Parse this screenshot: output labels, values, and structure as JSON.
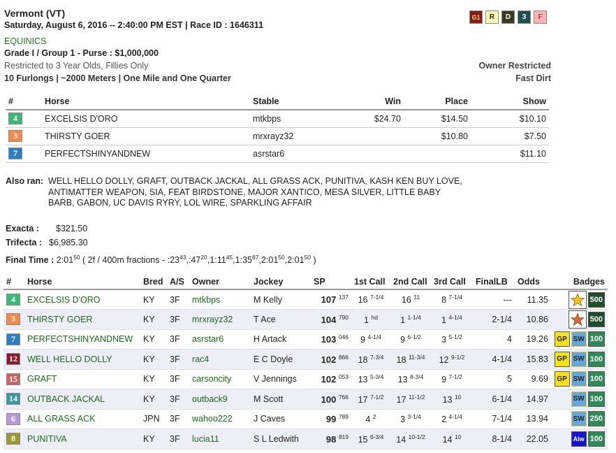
{
  "race": {
    "title": "Vermont (VT)",
    "datetime": "Saturday, August 6, 2016 -- 2:40:00 PM EST | Race ID : 1646311",
    "org": "EQUINICS",
    "grade": "Grade I / Group 1 - Purse : $1,000,000",
    "restriction": "Restricted to 3 Year Olds, Fillies Only",
    "distance": "10 Furlongs | ~2000 Meters | One Mile and One Quarter",
    "owner_restricted": "Owner Restricted",
    "surface": "Fast Dirt",
    "codes": [
      "G1",
      "R",
      "D",
      "3",
      "F"
    ]
  },
  "results_header": {
    "num": "#",
    "horse": "Horse",
    "stable": "Stable",
    "win": "Win",
    "place": "Place",
    "show": "Show"
  },
  "results": [
    {
      "pgm": "4",
      "color": "#3cb878",
      "horse": "EXCELSIS D'ORO",
      "stable": "mtkbps",
      "win": "$24.70",
      "place": "$14.50",
      "show": "$10.10"
    },
    {
      "pgm": "3",
      "color": "#f08c4a",
      "horse": "THIRSTY GOER",
      "stable": "mrxrayz32",
      "win": "",
      "place": "$10.80",
      "show": "$7.50"
    },
    {
      "pgm": "7",
      "color": "#2f7fc0",
      "horse": "PERFECTSHINYANDNEW",
      "stable": "asrstar6",
      "win": "",
      "place": "",
      "show": "$11.10"
    }
  ],
  "also_ran": {
    "label": "Also ran:",
    "text": "WELL HELLO DOLLY, GRAFT, OUTBACK JACKAL, ALL GRASS ACK, PUNITIVA, KASH KEN BUY LOVE, ANTIMATTER WEAPON, SIA, FEAT BIRDSTONE, MAJOR XANTICO, MESA SILVER, LITTLE BABY BARB, GABON, UC DAVIS RYRY, LOL WIRE, SPARKLING AFFAIR"
  },
  "payouts": {
    "exacta_label": "Exacta :",
    "exacta": "$321.50",
    "trifecta_label": "Trifecta :",
    "trifecta": "$6,985.30",
    "final_time_label": "Final Time :",
    "final_time": "2:01",
    "final_time_sup": "50",
    "fractions_prefix": "( 2f / 400m fractions - :23",
    "fractions": [
      {
        "main": ":23",
        "sup": "43"
      },
      {
        "main": ":47",
        "sup": "20"
      },
      {
        "main": "1:11",
        "sup": "45"
      },
      {
        "main": "1:35",
        "sup": "87"
      },
      {
        "main": "2:01",
        "sup": "50"
      },
      {
        "main": "2:01",
        "sup": "50"
      }
    ]
  },
  "main_header": {
    "num": "#",
    "horse": "Horse",
    "bred": "Bred",
    "as": "A/S",
    "owner": "Owner",
    "jockey": "Jockey",
    "sp": "SP",
    "call1": "1st Call",
    "call2": "2nd Call",
    "call3": "3rd Call",
    "finallb": "FinalLB",
    "odds": "Odds",
    "badges": "Badges"
  },
  "entries": [
    {
      "pgm": "4",
      "color": "#3cb878",
      "horse": "EXCELSIS D'ORO",
      "bred": "KY",
      "as": "3F",
      "owner": "mtkbps",
      "jockey": "M Kelly",
      "sp": "107",
      "sp_sup": "137",
      "c1": "16",
      "c1s": "7-1/4",
      "c2": "16",
      "c2s": "11",
      "c3": "8",
      "c3s": "7-1/4",
      "lb": "---",
      "odds": "11.35",
      "badges": [
        "star-gold",
        "500"
      ]
    },
    {
      "pgm": "3",
      "color": "#f08c4a",
      "horse": "THIRSTY GOER",
      "bred": "KY",
      "as": "3F",
      "owner": "mrxrayz32",
      "jockey": "T Ace",
      "sp": "104",
      "sp_sup": "790",
      "c1": "1",
      "c1s": "hd",
      "c2": "1",
      "c2s": "1-1/4",
      "c3": "1",
      "c3s": "4-1/4",
      "lb": "2-1/4",
      "odds": "10.86",
      "badges": [
        "star-bronze",
        "500"
      ]
    },
    {
      "pgm": "7",
      "color": "#2f7fc0",
      "horse": "PERFECTSHINYANDNEW",
      "bred": "KY",
      "as": "3F",
      "owner": "asrstar6",
      "jockey": "H Artack",
      "sp": "103",
      "sp_sup": "046",
      "c1": "9",
      "c1s": "4-1/4",
      "c2": "9",
      "c2s": "6-1/2",
      "c3": "3",
      "c3s": "5-1/2",
      "lb": "4",
      "odds": "19.26",
      "badges": [
        "GP",
        "SW",
        "100"
      ]
    },
    {
      "pgm": "12",
      "color": "#8b1a2a",
      "horse": "WELL HELLO DOLLY",
      "bred": "KY",
      "as": "3F",
      "owner": "rac4",
      "jockey": "E C Doyle",
      "sp": "102",
      "sp_sup": "866",
      "c1": "18",
      "c1s": "7-3/4",
      "c2": "18",
      "c2s": "11-3/4",
      "c3": "12",
      "c3s": "9-1/2",
      "lb": "4-1/4",
      "odds": "15.83",
      "badges": [
        "GP",
        "SW",
        "100"
      ]
    },
    {
      "pgm": "15",
      "color": "#c86464",
      "horse": "GRAFT",
      "bred": "KY",
      "as": "3F",
      "owner": "carsoncity",
      "jockey": "V Jennings",
      "sp": "102",
      "sp_sup": "053",
      "c1": "13",
      "c1s": "5-3/4",
      "c2": "13",
      "c2s": "8-3/4",
      "c3": "9",
      "c3s": "7-1/2",
      "lb": "5",
      "odds": "9.69",
      "badges": [
        "GP",
        "SW",
        "100"
      ]
    },
    {
      "pgm": "14",
      "color": "#3a9aa0",
      "horse": "OUTBACK JACKAL",
      "bred": "KY",
      "as": "3F",
      "owner": "outback9",
      "jockey": "M Scott",
      "sp": "100",
      "sp_sup": "766",
      "c1": "17",
      "c1s": "7-1/2",
      "c2": "17",
      "c2s": "11-1/2",
      "c3": "13",
      "c3s": "10",
      "lb": "6-1/4",
      "odds": "14.97",
      "badges": [
        "SW",
        "100"
      ]
    },
    {
      "pgm": "6",
      "color": "#b89ad8",
      "horse": "ALL GRASS ACK",
      "bred": "JPN",
      "as": "3F",
      "owner": "wahoo222",
      "jockey": "J Caves",
      "sp": "99",
      "sp_sup": "789",
      "c1": "4",
      "c1s": "2",
      "c2": "3",
      "c2s": "3-1/4",
      "c3": "2",
      "c3s": "4-1/4",
      "lb": "7-1/4",
      "odds": "13.94",
      "badges": [
        "SW",
        "250"
      ]
    },
    {
      "pgm": "8",
      "color": "#9a9a30",
      "horse": "PUNITIVA",
      "bred": "KY",
      "as": "3F",
      "owner": "lucia11",
      "jockey": "S L Ledwith",
      "sp": "98",
      "sp_sup": "819",
      "c1": "15",
      "c1s": "6-3/4",
      "c2": "14",
      "c2s": "10-1/2",
      "c3": "14",
      "c3s": "10",
      "lb": "8-1/4",
      "odds": "22.05",
      "badges": [
        "Alw",
        "100"
      ]
    }
  ]
}
